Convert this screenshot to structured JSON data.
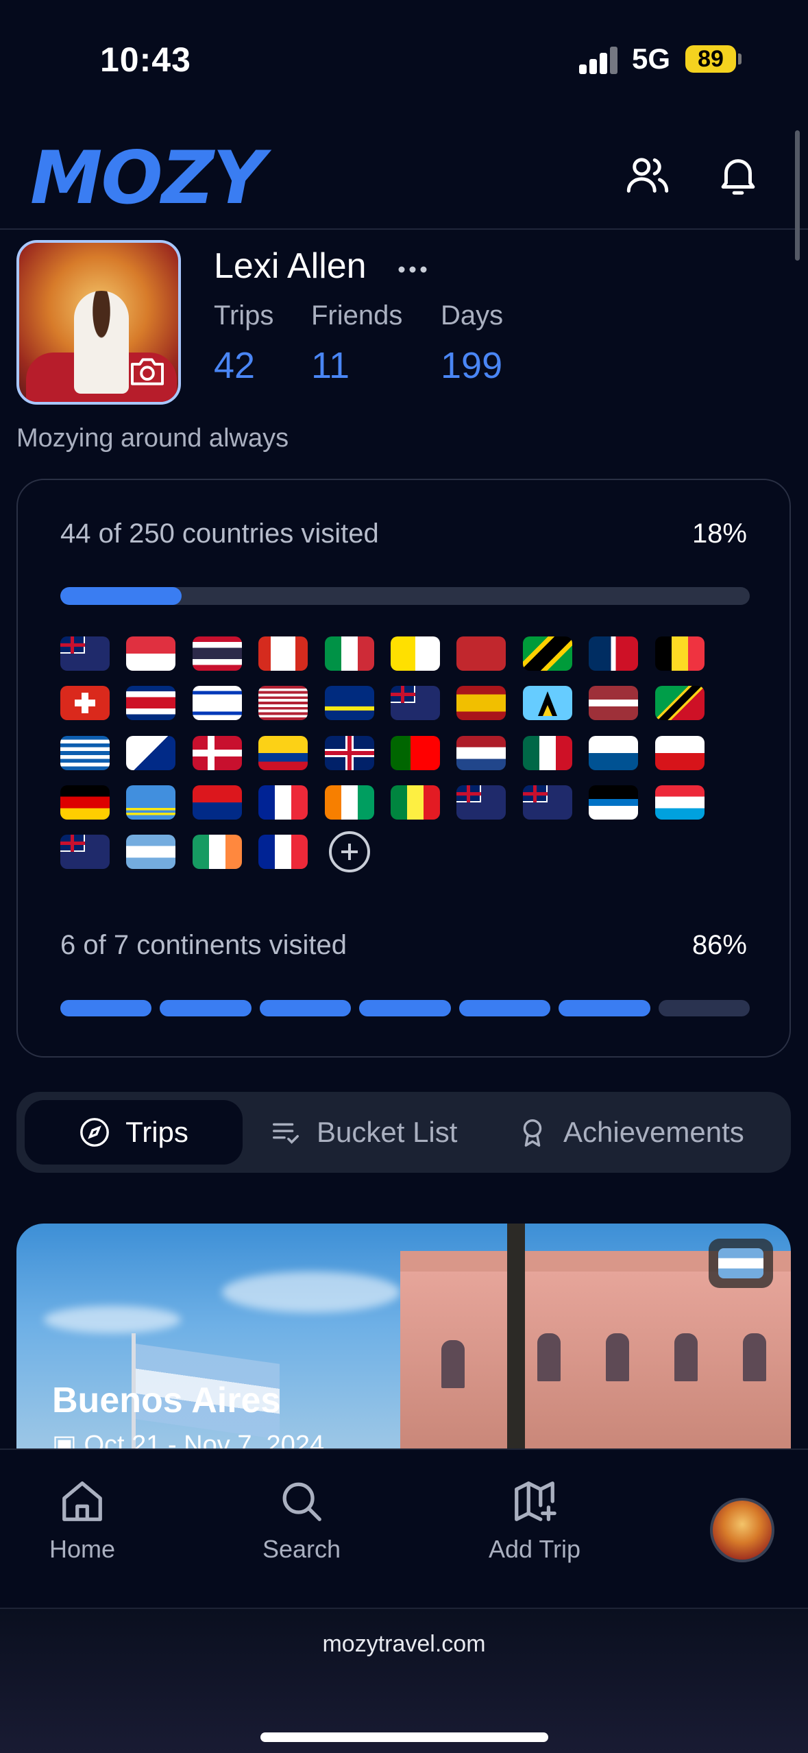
{
  "status_bar": {
    "time": "10:43",
    "network": "5G",
    "battery": "89"
  },
  "header": {
    "logo": "MOZY",
    "friends_icon": "users-icon",
    "notifications_icon": "bell-icon"
  },
  "profile": {
    "name": "Lexi Allen",
    "stats": [
      {
        "label": "Trips",
        "value": "42"
      },
      {
        "label": "Friends",
        "value": "11"
      },
      {
        "label": "Days",
        "value": "199"
      }
    ],
    "bio": "Mozying around always"
  },
  "countries": {
    "label": "44 of 250 countries visited",
    "percent": "18%",
    "progress": 0.176
  },
  "flags": [
    "anguilla",
    "singapore",
    "thailand",
    "canada",
    "italy",
    "vatican",
    "morocco",
    "jamaica",
    "dominican-republic",
    "belgium",
    "switzerland",
    "costa-rica",
    "israel",
    "usa",
    "curacao",
    "montserrat",
    "spain",
    "saint-lucia",
    "latvia",
    "saint-kitts",
    "greece",
    "bonaire",
    "denmark",
    "colombia",
    "uk",
    "portugal",
    "netherlands",
    "mexico",
    "panama",
    "czechia",
    "germany",
    "aruba",
    "sint-maarten",
    "france",
    "ivory-coast",
    "senegal",
    "new-zealand",
    "australia",
    "antigua",
    "luxembourg",
    "british-virgin-islands",
    "argentina",
    "ireland",
    "france-2"
  ],
  "continents": {
    "label": "6 of 7 continents visited",
    "percent": "86%",
    "visited": 6,
    "total": 7
  },
  "tabs": [
    {
      "label": "Trips",
      "icon": "compass-icon",
      "active": true
    },
    {
      "label": "Bucket List",
      "icon": "checklist-icon",
      "active": false
    },
    {
      "label": "Achievements",
      "icon": "award-icon",
      "active": false
    }
  ],
  "trip": {
    "title": "Buenos Aires",
    "dates": "Oct 21 - Nov 7, 2024",
    "flag": "argentina"
  },
  "bottom_nav": [
    {
      "label": "Home",
      "icon": "home-icon"
    },
    {
      "label": "Search",
      "icon": "search-icon"
    },
    {
      "label": "Add Trip",
      "icon": "map-plus-icon"
    }
  ],
  "browser": {
    "url": "mozytravel.com"
  },
  "colors": {
    "accent": "#3a7df2",
    "background": "#050a1c",
    "muted": "#aab0c0",
    "track": "#2a3145"
  }
}
